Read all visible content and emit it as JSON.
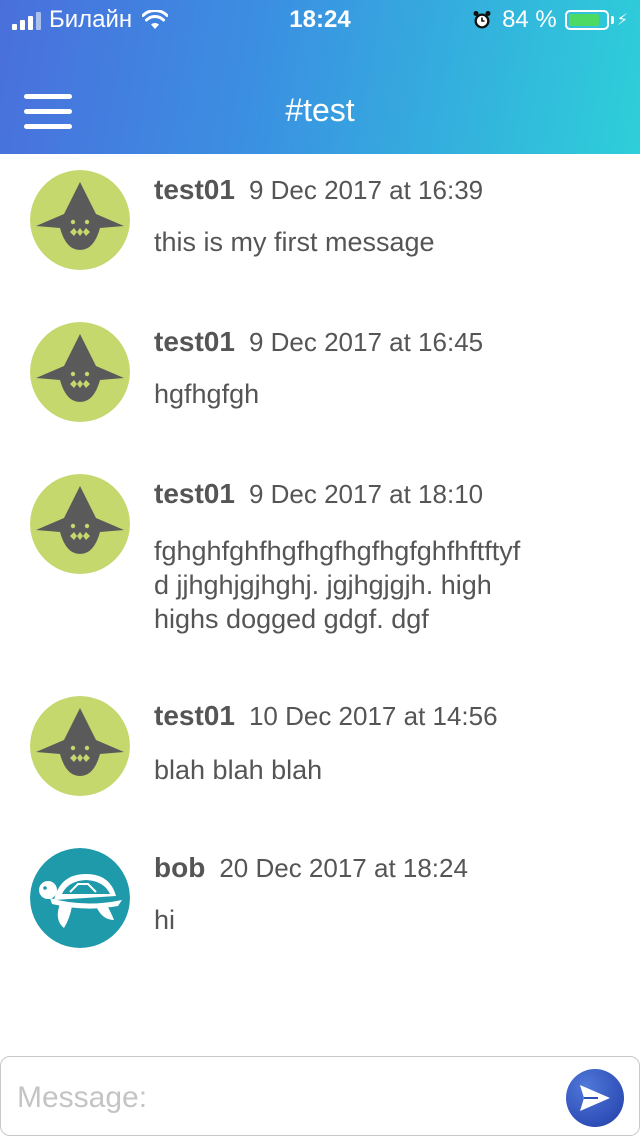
{
  "status_bar": {
    "carrier": "Билайн",
    "time": "18:24",
    "battery_percent": "84 %",
    "battery_level": 0.84,
    "battery_color": "#4cd964"
  },
  "header": {
    "title": "#test",
    "menu_icon": "hamburger-menu-icon",
    "gradient_start": "#4a6fdc",
    "gradient_end": "#2dcfd9"
  },
  "messages": [
    {
      "user": "test01",
      "timestamp": "9 Dec 2017 at 16:39",
      "text": "this is my first message",
      "avatar": "shark-avatar"
    },
    {
      "user": "test01",
      "timestamp": "9 Dec 2017 at 16:45",
      "text": "hgfhgfgh",
      "avatar": "shark-avatar"
    },
    {
      "user": "test01",
      "timestamp": "9 Dec 2017 at 18:10",
      "text": "fghghfghfhgfhgfhgfhgfghfhftftyf\nd jjhghjgjhghj. jgjhgjgjh.  high\nhighs dogged gdgf.  dgf",
      "avatar": "shark-avatar"
    },
    {
      "user": "test01",
      "timestamp": "10 Dec 2017 at 14:56",
      "text": "blah blah blah",
      "avatar": "shark-avatar"
    },
    {
      "user": "bob",
      "timestamp": "20 Dec 2017 at 18:24",
      "text": "hi",
      "avatar": "turtle-avatar"
    }
  ],
  "composer": {
    "placeholder": "Message:",
    "value": "",
    "send_icon": "paper-plane-icon"
  },
  "colors": {
    "shark_avatar_bg": "#c5d86d",
    "turtle_avatar_bg": "#1e9aab",
    "send_button": "#2f4fb8"
  }
}
